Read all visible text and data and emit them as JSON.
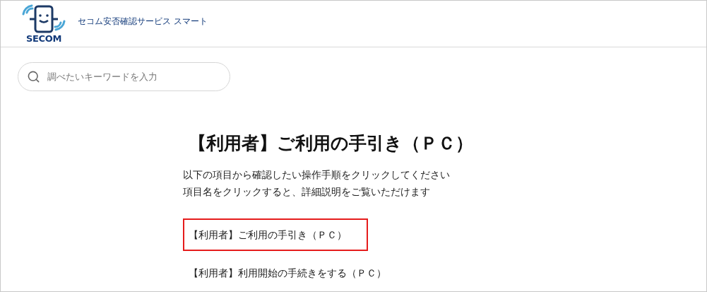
{
  "header": {
    "logo_text": "SECOM",
    "service_name": "セコム安否確認サービス スマート"
  },
  "search": {
    "placeholder": "調べたいキーワードを入力"
  },
  "article": {
    "title": "【利用者】ご利用の手引き（ＰＣ）",
    "intro": [
      "以下の項目から確認したい操作手順をクリックしてください",
      "項目名をクリックすると、詳細説明をご覧いただけます"
    ],
    "items": [
      {
        "label": "【利用者】ご利用の手引き（ＰＣ）",
        "selected": true
      },
      {
        "label": "【利用者】利用開始の手続きをする（ＰＣ）",
        "selected": false
      }
    ]
  }
}
